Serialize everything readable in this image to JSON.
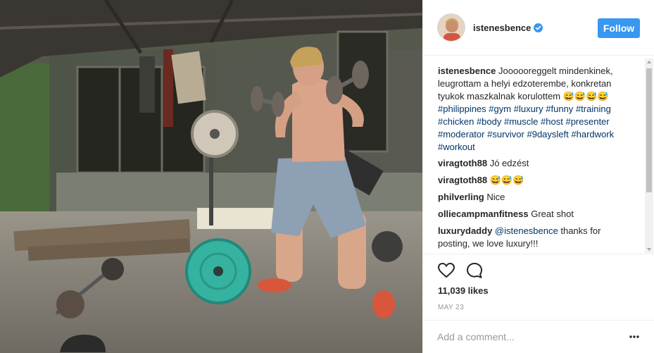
{
  "post": {
    "username": "istenesbence",
    "verified": true,
    "follow_label": "Follow",
    "caption": {
      "username": "istenesbence",
      "text": "Joooooreggelt mindenkinek, leugrottam a helyi edzoterembe, konkretan tyukok maszkalnak korulottem 😅😅😅😅",
      "hashtags": [
        "#philippines",
        "#gym",
        "#luxury",
        "#funny",
        "#training",
        "#chicken",
        "#body",
        "#muscle",
        "#host",
        "#presenter",
        "#moderator",
        "#survivor",
        "#9daysleft",
        "#hardwork",
        "#workout"
      ]
    },
    "comments": [
      {
        "username": "viragtoth88",
        "text": "Jó edzést"
      },
      {
        "username": "viragtoth88",
        "text": "😅😅😅"
      },
      {
        "username": "philverling",
        "text": "Nice"
      },
      {
        "username": "olliecampmanfitness",
        "text": "Great shot"
      },
      {
        "username": "luxurydaddy",
        "mention": "@istenesbence",
        "text": "thanks for posting, we love luxury!!!"
      }
    ],
    "likes": "11,039 likes",
    "date": "MAY 23",
    "add_comment_placeholder": "Add a comment...",
    "icons": {
      "verified": "verified-badge-icon",
      "like": "heart-icon",
      "comment": "comment-bubble-icon",
      "more": "more-options-icon"
    },
    "colors": {
      "follow_button": "#3897f0",
      "hashtag": "#003569",
      "verified_badge": "#3897f0"
    }
  }
}
